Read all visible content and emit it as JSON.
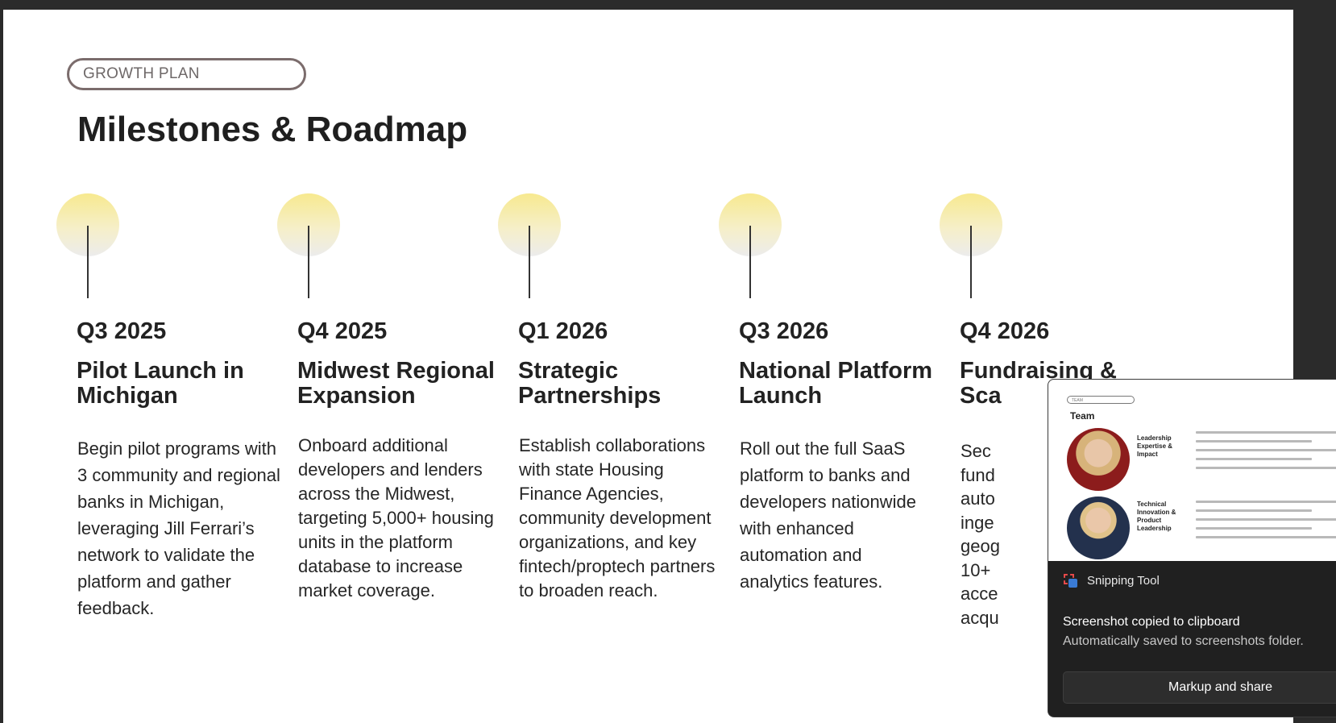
{
  "slide": {
    "tag": "GROWTH PLAN",
    "title": "Milestones & Roadmap",
    "milestones": [
      {
        "date": "Q3 2025",
        "title": "Pilot Launch in Michigan",
        "description": "Begin pilot programs with 3 community and regional banks in Michigan, leveraging Jill Ferrari’s network to validate the platform and gather feedback."
      },
      {
        "date": "Q4 2025",
        "title": "Midwest Regional Expansion",
        "description": "Onboard additional developers and lenders across the Midwest, targeting 5,000+ housing units in the platform database to increase market coverage."
      },
      {
        "date": "Q1 2026",
        "title": "Strategic Partnerships",
        "description": "Establish collaborations with state Housing Finance Agencies, community development organizations, and key fintech/proptech partners to broaden reach."
      },
      {
        "date": "Q3 2026",
        "title": "National Platform Launch",
        "description": "Roll out the full SaaS platform to banks and developers nationwide with enhanced automation and analytics features."
      },
      {
        "date": "Q4 2026",
        "title": "Fundraising & Sca",
        "description": "Sec fund auto inge geog 10+ acce acqu"
      }
    ]
  },
  "toast": {
    "app_name": "Snipping Tool",
    "message": "Screenshot copied to clipboard",
    "submessage": "Automatically saved to screenshots folder.",
    "button_label": "Markup and share",
    "preview": {
      "tag": "TEAM",
      "title": "Team",
      "label_1": "Leadership Expertise & Impact",
      "label_2": "Technical Innovation & Product Leadership"
    }
  }
}
